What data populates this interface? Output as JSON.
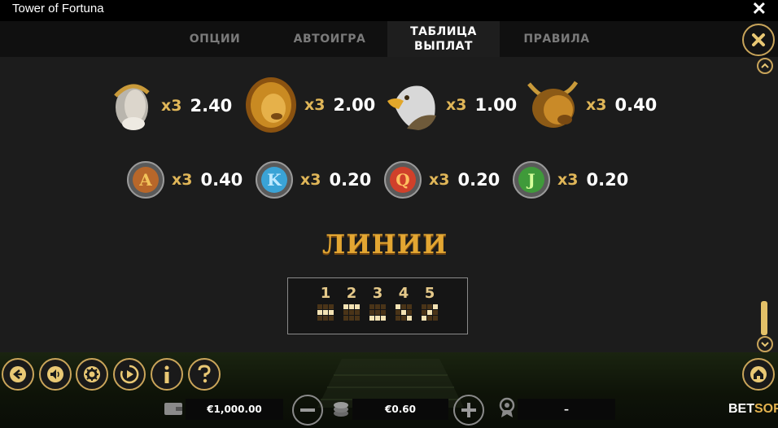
{
  "window": {
    "title": "Tower of Fortuna"
  },
  "tabs": [
    {
      "label": "ОПЦИИ"
    },
    {
      "label": "АВТОИГРА"
    },
    {
      "label": "ТАБЛИЦА ВЫПЛАТ",
      "active": true
    },
    {
      "label": "ПРАВИЛА"
    }
  ],
  "paytable": {
    "row1": [
      {
        "symbol": "caesar-head",
        "mult": "x3",
        "pay": "2.40"
      },
      {
        "symbol": "lion-head",
        "mult": "x3",
        "pay": "2.00"
      },
      {
        "symbol": "eagle-head",
        "mult": "x3",
        "pay": "1.00"
      },
      {
        "symbol": "bull-head",
        "mult": "x3",
        "pay": "0.40"
      }
    ],
    "row2": [
      {
        "symbol": "A",
        "color": "#b8672a",
        "mult": "x3",
        "pay": "0.40"
      },
      {
        "symbol": "K",
        "color": "#3aa3d6",
        "mult": "x3",
        "pay": "0.20"
      },
      {
        "symbol": "Q",
        "color": "#d0402a",
        "mult": "x3",
        "pay": "0.20"
      },
      {
        "symbol": "J",
        "color": "#3f9a3a",
        "mult": "x3",
        "pay": "0.20"
      }
    ]
  },
  "lines": {
    "title": "ЛИНИИ",
    "items": [
      {
        "num": "1",
        "pattern": [
          0,
          0,
          0,
          1,
          1,
          1,
          0,
          0,
          0
        ]
      },
      {
        "num": "2",
        "pattern": [
          1,
          1,
          1,
          0,
          0,
          0,
          0,
          0,
          0
        ]
      },
      {
        "num": "3",
        "pattern": [
          0,
          0,
          0,
          0,
          0,
          0,
          1,
          1,
          1
        ]
      },
      {
        "num": "4",
        "pattern": [
          1,
          0,
          0,
          0,
          1,
          0,
          0,
          0,
          1
        ]
      },
      {
        "num": "5",
        "pattern": [
          0,
          0,
          1,
          0,
          1,
          0,
          1,
          0,
          0
        ]
      }
    ]
  },
  "bottom": {
    "balance": "€1,000.00",
    "bet": "€0.60",
    "win": "–",
    "brand_left": "BET",
    "brand_right": "SOFT"
  },
  "colors": {
    "gold": "#c8a45a",
    "accent": "#e3a632"
  }
}
